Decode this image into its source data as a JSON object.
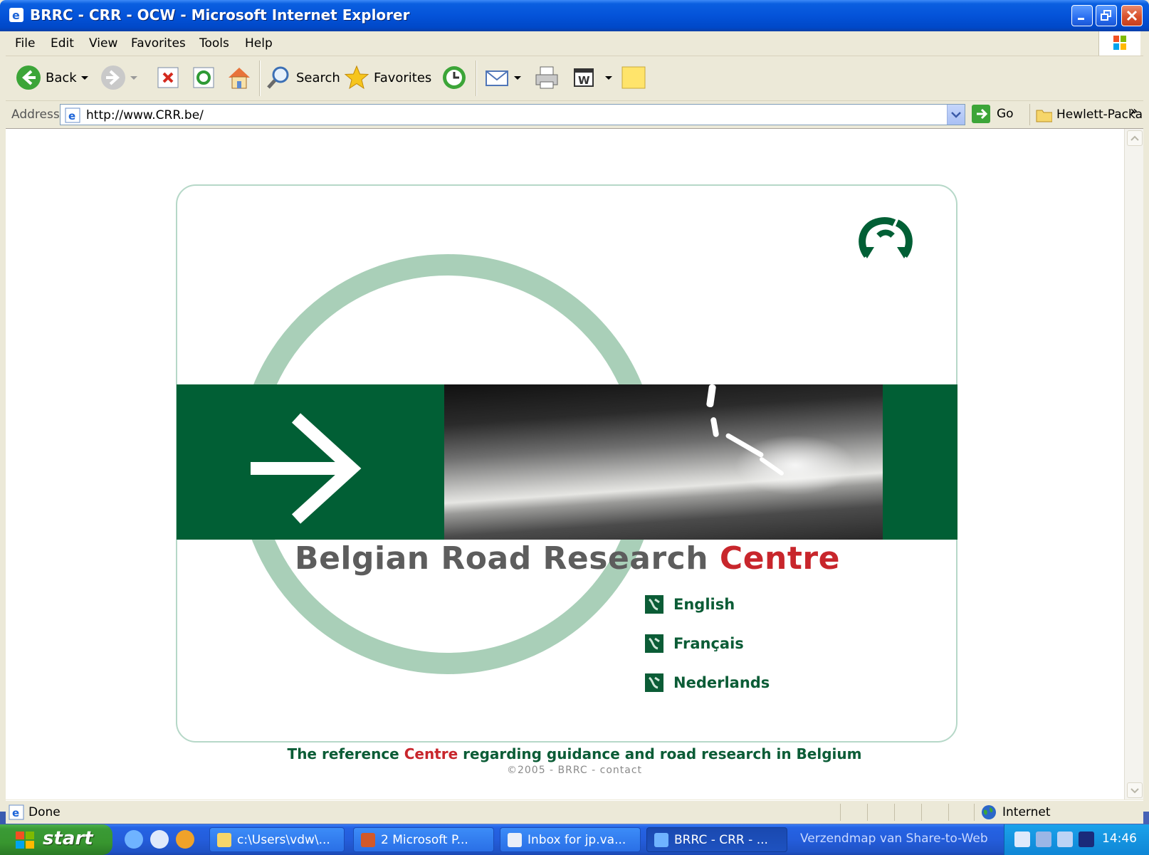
{
  "window": {
    "title": "BRRC - CRR - OCW - Microsoft Internet Explorer"
  },
  "menu": [
    "File",
    "Edit",
    "View",
    "Favorites",
    "Tools",
    "Help"
  ],
  "toolbar": {
    "back_label": "Back",
    "search_label": "Search",
    "favorites_label": "Favorites"
  },
  "address": {
    "label": "Address",
    "url": "http://www.CRR.be/",
    "go_label": "Go",
    "links_label": "Hewlett-Packa"
  },
  "page": {
    "brand_main": "Belgian Road Research ",
    "brand_accent": "Centre",
    "languages": [
      "English",
      "Français",
      "Nederlands"
    ],
    "tagline_pre": "The reference ",
    "tagline_accent": "Centre",
    "tagline_post": " regarding guidance and road research in Belgium",
    "copyright": "©2005 - BRRC - contact",
    "colors": {
      "brand_green": "#015f35",
      "ring_green": "#a9cfb8",
      "accent_red": "#c8262c"
    }
  },
  "status": {
    "text": "Done",
    "zone": "Internet"
  },
  "taskbar": {
    "start_label": "start",
    "tasks": [
      "c:\\Users\\vdw\\...",
      "2 Microsoft P...",
      "Inbox for jp.va...",
      "BRRC - CRR - ..."
    ],
    "share_text": "Verzendmap van Share-to-Web",
    "clock": "14:46"
  }
}
